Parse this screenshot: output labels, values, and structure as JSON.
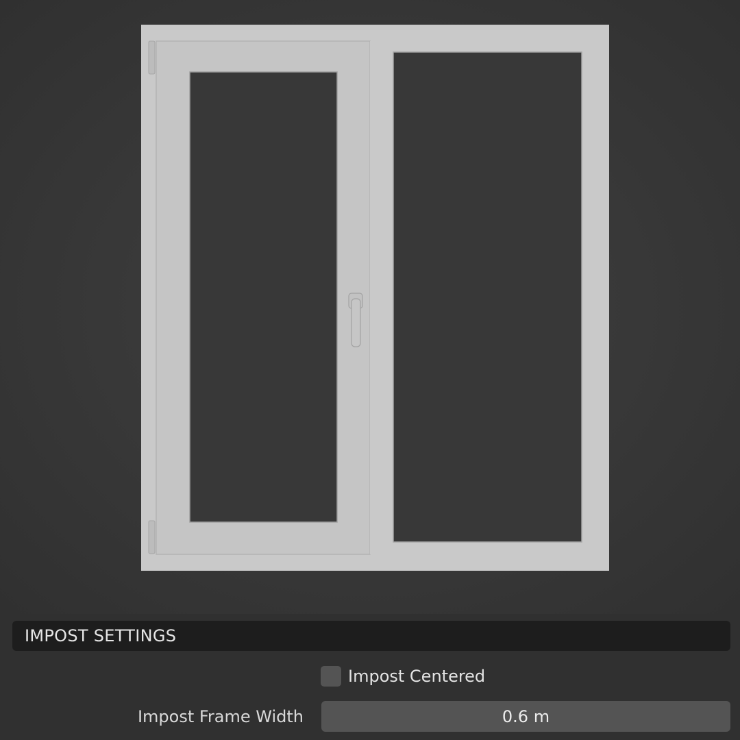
{
  "panel": {
    "section_title": "IMPOST SETTINGS",
    "impost_centered": {
      "label": "Impost Centered",
      "checked": false
    },
    "impost_frame_width": {
      "label": "Impost Frame Width",
      "value": "0.6 m"
    }
  },
  "colors": {
    "viewport_background": "#3a3a3a",
    "window_frame": "#c8c8c8",
    "glass": "#383838",
    "panel_background": "#303030",
    "header_background": "#1d1d1d",
    "field_background": "#545454"
  },
  "icons": {
    "window_handle": "handle-icon",
    "hinge": "hinge-icon"
  }
}
